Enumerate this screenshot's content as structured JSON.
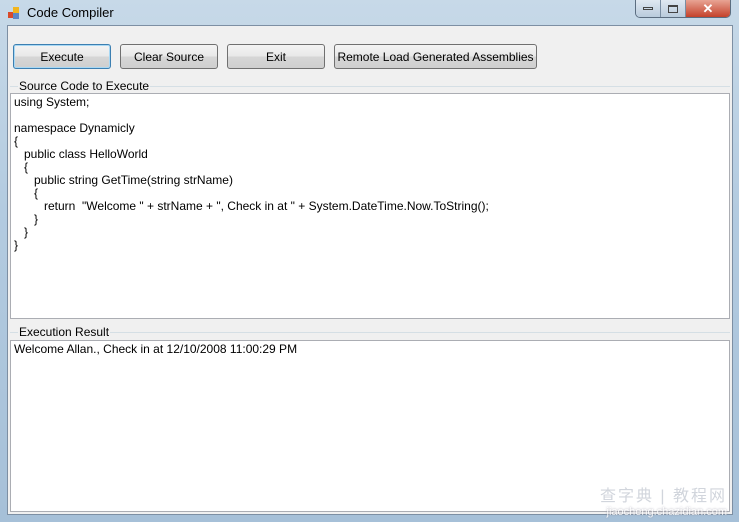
{
  "window": {
    "title": "Code Compiler",
    "icon": "app-window-icon",
    "controls": [
      "minimize-icon",
      "maximize-icon",
      "close-icon"
    ]
  },
  "toolbar": {
    "execute_label": "Execute",
    "clear_label": "Clear Source",
    "exit_label": "Exit",
    "remote_label": "Remote Load Generated Assemblies"
  },
  "source": {
    "label": "Source Code to Execute",
    "code": "using System;\n\nnamespace Dynamicly\n{\n   public class HelloWorld\n   {\n      public string GetTime(string strName)\n      {\n         return  \"Welcome \" + strName + \", Check in at \" + System.DateTime.Now.ToString();\n      }\n   }\n}"
  },
  "result": {
    "label": "Execution Result",
    "text": "Welcome Allan., Check in at 12/10/2008 11:00:29 PM"
  },
  "watermark": {
    "cn": "查字典 | 教程网",
    "url": "jiaocheng.chazidian.com"
  }
}
